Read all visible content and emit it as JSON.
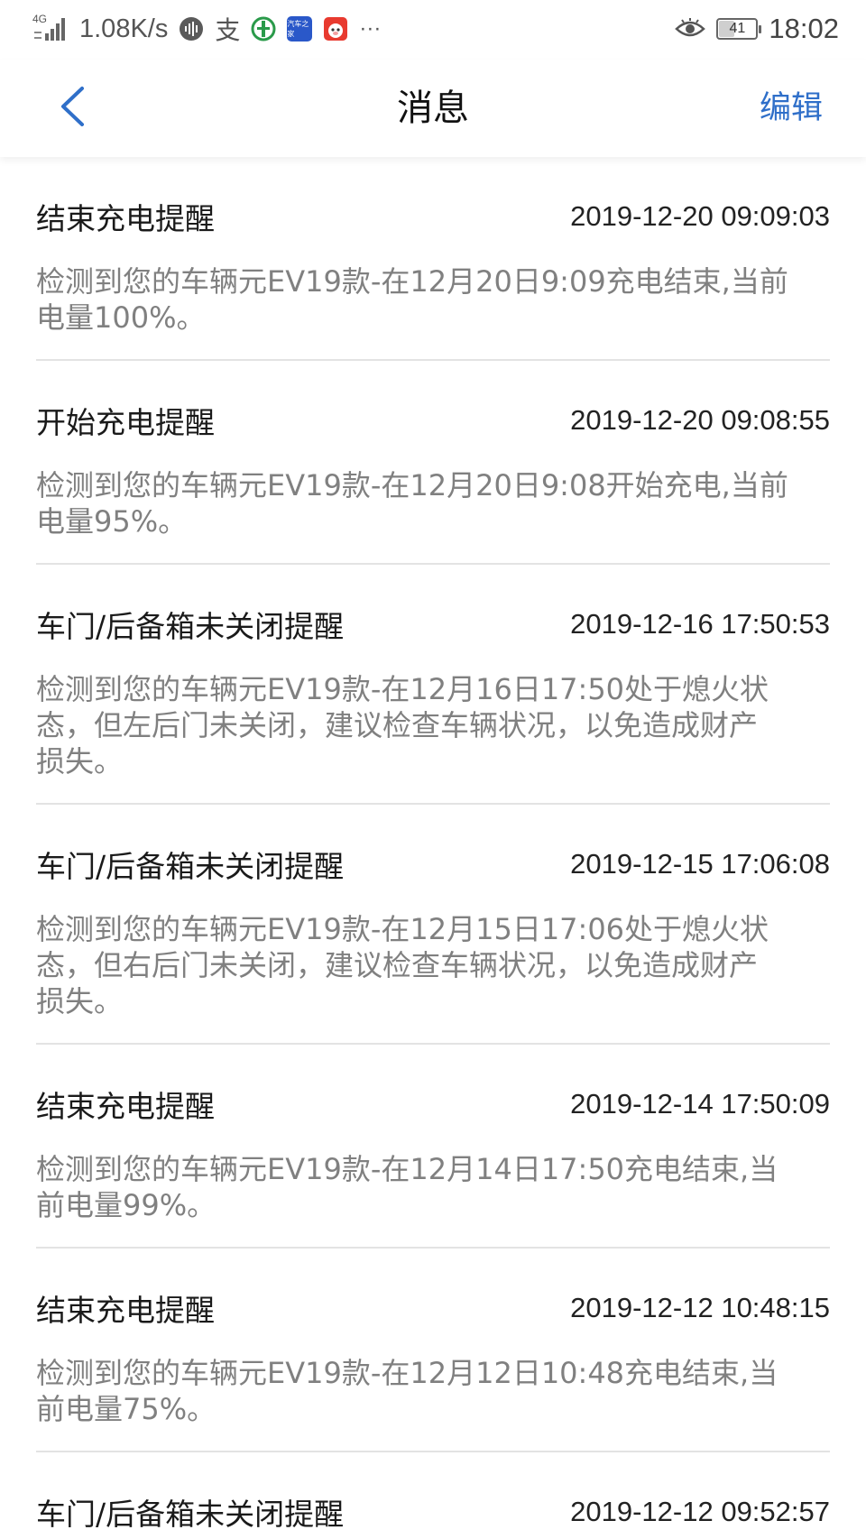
{
  "status_bar": {
    "network_label": "4G",
    "speed": "1.08K/s",
    "alipay_char": "支",
    "app_chip_label": "汽车之家",
    "battery": "41",
    "battery_level": 0.41,
    "time": "18:02",
    "overflow": "···"
  },
  "nav": {
    "back_icon": "chevron-left-icon",
    "title": "消息",
    "edit_label": "编辑"
  },
  "colors": {
    "accent": "#2f6fc9",
    "body_text": "#808080",
    "divider": "#e3e3e3"
  },
  "messages": [
    {
      "title": "结束充电提醒",
      "time": "2019-12-20 09:09:03",
      "lines": [
        "检测到您的车辆元EV19款-在12月20日9:09充电结束,当前",
        "电量100%。"
      ]
    },
    {
      "title": "开始充电提醒",
      "time": "2019-12-20 09:08:55",
      "lines": [
        "检测到您的车辆元EV19款-在12月20日9:08开始充电,当前",
        "电量95%。"
      ]
    },
    {
      "title": "车门/后备箱未关闭提醒",
      "time": "2019-12-16 17:50:53",
      "lines": [
        "检测到您的车辆元EV19款-在12月16日17:50处于熄火状",
        "态，但左后门未关闭，建议检查车辆状况，以免造成财产",
        "损失。"
      ]
    },
    {
      "title": "车门/后备箱未关闭提醒",
      "time": "2019-12-15 17:06:08",
      "lines": [
        "检测到您的车辆元EV19款-在12月15日17:06处于熄火状",
        "态，但右后门未关闭，建议检查车辆状况，以免造成财产",
        "损失。"
      ]
    },
    {
      "title": "结束充电提醒",
      "time": "2019-12-14 17:50:09",
      "lines": [
        "检测到您的车辆元EV19款-在12月14日17:50充电结束,当",
        "前电量99%。"
      ]
    },
    {
      "title": "结束充电提醒",
      "time": "2019-12-12 10:48:15",
      "lines": [
        "检测到您的车辆元EV19款-在12月12日10:48充电结束,当",
        "前电量75%。"
      ]
    },
    {
      "title": "车门/后备箱未关闭提醒",
      "time": "2019-12-12 09:52:57",
      "lines": []
    }
  ]
}
